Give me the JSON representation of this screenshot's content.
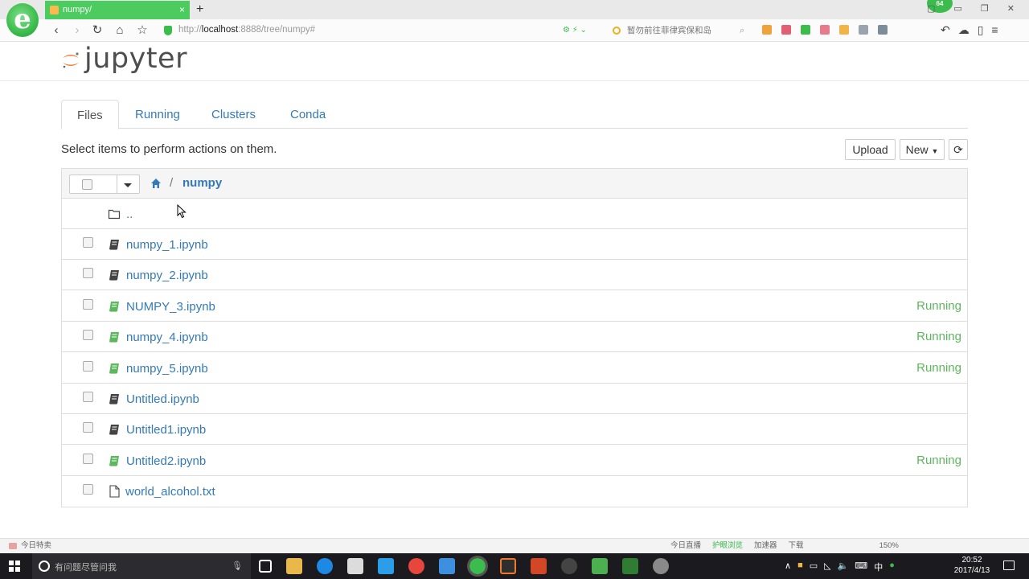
{
  "browser": {
    "tab_title": "numpy/",
    "tab_close": "×",
    "new_tab": "+",
    "window_controls": "▢ ▭ ❐ ✕",
    "badge": "64",
    "url_scheme": "http://",
    "url_host": "localhost",
    "url_path": ":8888/tree/numpy#",
    "search_placeholder": "暂勿前往菲律宾保和岛",
    "status_left": "今日特卖",
    "status_right": [
      "今日直播",
      "护眼浏览",
      "加速器",
      "下载",
      "150%"
    ]
  },
  "jupyter": {
    "logo_text": "jupyter",
    "tabs": [
      {
        "label": "Files",
        "active": true
      },
      {
        "label": "Running",
        "active": false
      },
      {
        "label": "Clusters",
        "active": false
      },
      {
        "label": "Conda",
        "active": false
      }
    ],
    "instructions": "Select items to perform actions on them.",
    "upload_label": "Upload",
    "new_label": "New",
    "refresh_glyph": "⟳",
    "breadcrumb_sep": "/",
    "breadcrumb_dir": "numpy",
    "parent_dir": "..",
    "files": [
      {
        "name": "numpy_1.ipynb",
        "type": "notebook",
        "status": ""
      },
      {
        "name": "numpy_2.ipynb",
        "type": "notebook",
        "status": ""
      },
      {
        "name": "NUMPY_3.ipynb",
        "type": "notebook-running",
        "status": "Running"
      },
      {
        "name": "numpy_4.ipynb",
        "type": "notebook-running",
        "status": "Running"
      },
      {
        "name": "numpy_5.ipynb",
        "type": "notebook-running",
        "status": "Running"
      },
      {
        "name": "Untitled.ipynb",
        "type": "notebook",
        "status": ""
      },
      {
        "name": "Untitled1.ipynb",
        "type": "notebook",
        "status": ""
      },
      {
        "name": "Untitled2.ipynb",
        "type": "notebook-running",
        "status": "Running"
      },
      {
        "name": "world_alcohol.txt",
        "type": "file",
        "status": ""
      }
    ]
  },
  "taskbar": {
    "search_placeholder": "有问题尽管问我",
    "ime": "中",
    "time": "20:52",
    "date": "2017/4/13"
  },
  "colors": {
    "link": "#337ab7",
    "running": "#5cb85c",
    "browser_green": "#4ccb5e",
    "jupyter_orange": "#f37726"
  }
}
